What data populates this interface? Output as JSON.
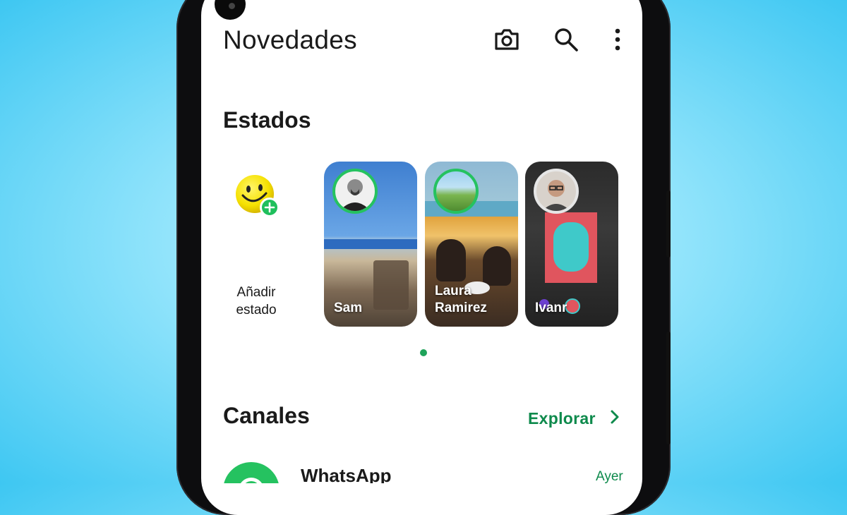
{
  "header": {
    "title": "Novedades",
    "camera_icon": "camera-icon",
    "search_icon": "search-icon",
    "more_icon": "more-vertical-icon"
  },
  "status": {
    "section_title": "Estados",
    "add_status_label_line1": "Añadir",
    "add_status_label_line2": "estado",
    "items": [
      {
        "name_line1": "Sam",
        "name_line2": ""
      },
      {
        "name_line1": "Laura",
        "name_line2": "Ramirez"
      },
      {
        "name_line1": "Ivanr",
        "name_line2": ""
      }
    ]
  },
  "channels": {
    "section_title": "Canales",
    "explore_label": "Explorar",
    "items": [
      {
        "name": "WhatsApp",
        "time": "Ayer"
      }
    ]
  },
  "colors": {
    "accent_green": "#0e8a4c",
    "ring_green": "#25c260",
    "background_cyan": "#3ec7f2"
  }
}
